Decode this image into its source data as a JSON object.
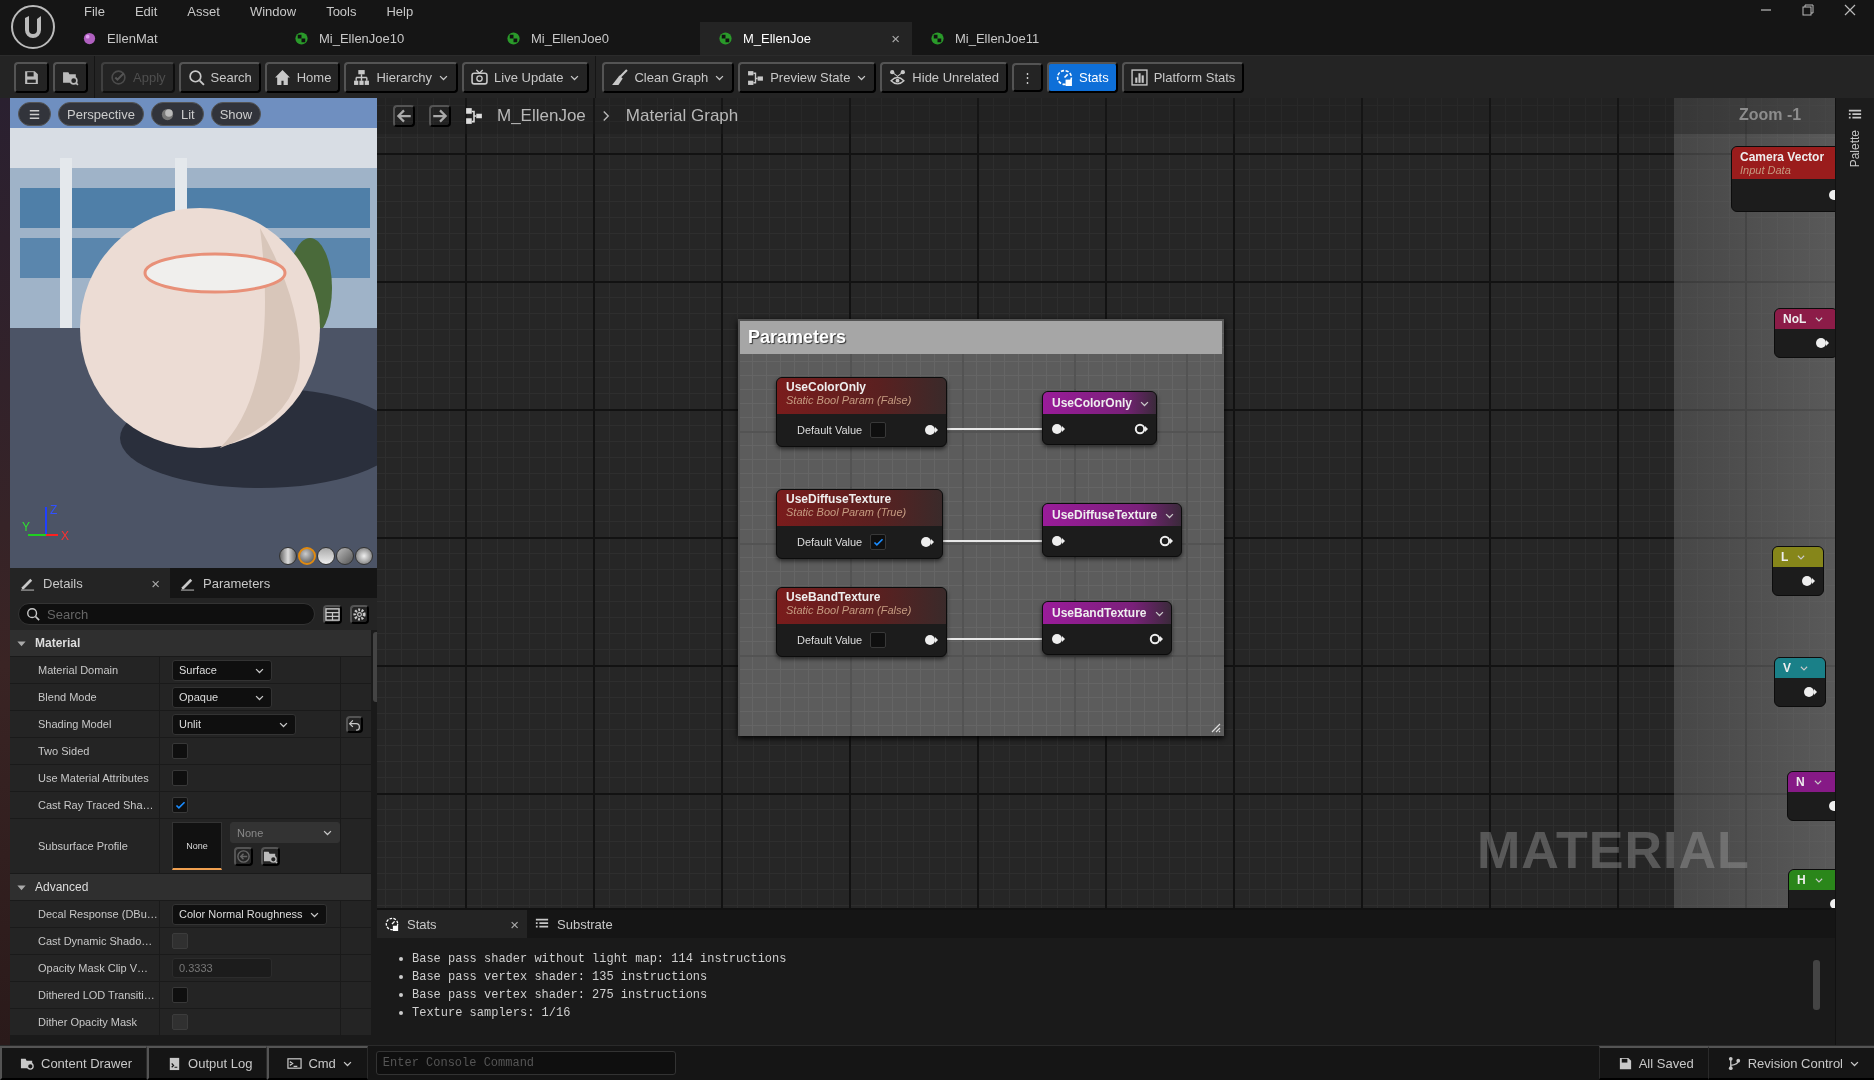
{
  "menu": [
    {
      "label": "File"
    },
    {
      "label": "Edit"
    },
    {
      "label": "Asset"
    },
    {
      "label": "Window"
    },
    {
      "label": "Tools"
    },
    {
      "label": "Help"
    }
  ],
  "document_tabs": [
    {
      "label": "EllenMat",
      "kind": "material",
      "selected": false
    },
    {
      "label": "Mi_EllenJoe10",
      "kind": "instance",
      "selected": false
    },
    {
      "label": "Mi_EllenJoe0",
      "kind": "instance",
      "selected": false
    },
    {
      "label": "M_EllenJoe",
      "kind": "instance",
      "selected": true,
      "close": "×"
    },
    {
      "label": "Mi_EllenJoe11",
      "kind": "instance",
      "selected": false
    }
  ],
  "toolbar": [
    [
      {
        "kind": "save",
        "disabled": false,
        "selected": false
      },
      {
        "kind": "browse",
        "disabled": false,
        "selected": false
      }
    ],
    [
      {
        "kind": "apply",
        "label": "Apply",
        "disabled": true,
        "selected": false
      },
      {
        "kind": "search",
        "label": "Search",
        "disabled": false,
        "selected": false
      },
      {
        "kind": "home",
        "label": "Home",
        "disabled": false,
        "selected": false
      },
      {
        "kind": "hierarchy",
        "label": "Hierarchy",
        "dropdown": true,
        "disabled": false,
        "selected": false
      },
      {
        "kind": "live",
        "label": "Live Update",
        "dropdown": true,
        "disabled": false,
        "selected": false
      }
    ],
    [
      {
        "kind": "clean",
        "label": "Clean Graph",
        "dropdown": true,
        "disabled": false,
        "selected": false
      },
      {
        "kind": "preview",
        "label": "Preview State",
        "dropdown": true,
        "disabled": false,
        "selected": false
      },
      {
        "kind": "hide",
        "label": "Hide Unrelated",
        "disabled": false,
        "selected": false
      },
      {
        "kind": "more",
        "label": "⋮",
        "disabled": false,
        "selected": false
      },
      {
        "kind": "stats",
        "label": "Stats",
        "disabled": false,
        "selected": true
      },
      {
        "kind": "platform",
        "label": "Platform Stats",
        "disabled": false,
        "selected": false
      }
    ]
  ],
  "viewport": {
    "buttons": [
      {
        "kind": "menu"
      },
      {
        "kind": "text",
        "label": "Perspective"
      },
      {
        "kind": "lit",
        "label": "Lit"
      },
      {
        "kind": "text",
        "label": "Show"
      }
    ],
    "axes": [
      "Z",
      "Y",
      "X"
    ],
    "preview_shapes": [
      {
        "kind": "cylinder",
        "selected": false
      },
      {
        "kind": "sphere",
        "selected": true
      },
      {
        "kind": "plane",
        "selected": false
      },
      {
        "kind": "cube",
        "selected": false
      },
      {
        "kind": "mesh",
        "selected": false
      }
    ]
  },
  "details": {
    "tabs": [
      {
        "label": "Details",
        "selected": true,
        "close": "×"
      },
      {
        "label": "Parameters",
        "selected": false
      }
    ],
    "search": {
      "placeholder": "Search"
    },
    "sections": [
      {
        "title": "Material",
        "expanded": true,
        "rows": [
          {
            "label": "Material Domain",
            "kind": "dropdown",
            "value": "Surface",
            "modified": false
          },
          {
            "label": "Blend Mode",
            "kind": "dropdown",
            "value": "Opaque",
            "modified": false
          },
          {
            "label": "Shading Model",
            "kind": "dropdown",
            "value": "Unlit",
            "modified": true
          },
          {
            "label": "Two Sided",
            "kind": "checkbox",
            "checked": false,
            "disabled": false,
            "modified": false
          },
          {
            "label": "Use Material Attributes",
            "kind": "checkbox",
            "checked": false,
            "disabled": false,
            "modified": false
          },
          {
            "label": "Cast Ray Traced Sha…",
            "kind": "checkbox",
            "checked": true,
            "disabled": false,
            "modified": false
          },
          {
            "label": "Subsurface Profile",
            "kind": "asset",
            "thumbnail": "None",
            "value": "None",
            "modified": false
          }
        ]
      },
      {
        "title": "Advanced",
        "expanded": true,
        "rows": [
          {
            "label": "Decal Response (DBu…",
            "kind": "dropdown",
            "value": "Color Normal Roughness",
            "modified": false
          },
          {
            "label": "Cast Dynamic Shado…",
            "kind": "checkbox",
            "checked": false,
            "disabled": true,
            "modified": false
          },
          {
            "label": "Opacity Mask Clip V…",
            "kind": "number",
            "value": "0.3333",
            "disabled": true,
            "modified": false
          },
          {
            "label": "Dithered LOD Transiti…",
            "kind": "checkbox",
            "checked": false,
            "disabled": false,
            "modified": false
          },
          {
            "label": "Dither Opacity Mask",
            "kind": "checkbox",
            "checked": false,
            "disabled": true,
            "modified": false
          }
        ]
      }
    ]
  },
  "graph": {
    "breadcrumb": [
      "M_EllenJoe",
      "Material Graph"
    ],
    "zoom_label": "Zoom -1",
    "watermark": "MATERIAL",
    "comment": {
      "title": "Parameters",
      "parameters": [
        {
          "name": "UseColorOnly",
          "subtitle": "Static Bool Param (False)",
          "pin_label": "Default Value",
          "checked": false
        },
        {
          "name": "UseDiffuseTexture",
          "subtitle": "Static Bool Param (True)",
          "pin_label": "Default Value",
          "checked": true
        },
        {
          "name": "UseBandTexture",
          "subtitle": "Static Bool Param (False)",
          "pin_label": "Default Value",
          "checked": false
        }
      ],
      "switches": [
        {
          "title": "UseColorOnly"
        },
        {
          "title": "UseDiffuseTexture"
        },
        {
          "title": "UseBandTexture"
        }
      ]
    },
    "side_nodes": [
      {
        "title": "Camera Vector",
        "subtitle": "Input Data",
        "color": "#9a1c1c",
        "dropdown": false
      },
      {
        "title": "NoL",
        "color": "#8c1c48",
        "dropdown": true
      },
      {
        "title": "L",
        "color": "#86861a",
        "dropdown": true
      },
      {
        "title": "V",
        "color": "#1a8088",
        "dropdown": true
      },
      {
        "title": "N",
        "color": "#861a86",
        "dropdown": true
      },
      {
        "title": "H",
        "color": "#2a861a",
        "dropdown": true
      }
    ]
  },
  "stats": {
    "tabs": [
      {
        "label": "Stats",
        "selected": true,
        "close": "×"
      },
      {
        "label": "Substrate",
        "selected": false
      }
    ],
    "lines": [
      "Base pass shader without light map: 114 instructions",
      "Base pass vertex shader: 135 instructions",
      "Base pass vertex shader: 275 instructions",
      "Texture samplers: 1/16"
    ]
  },
  "palette": {
    "label": "Palette"
  },
  "status_bar": {
    "left": [
      {
        "kind": "drawer",
        "label": "Content Drawer"
      },
      {
        "kind": "log",
        "label": "Output Log"
      },
      {
        "kind": "cmd",
        "label": "Cmd",
        "dropdown": true
      }
    ],
    "console": {
      "placeholder": "Enter Console Command"
    },
    "right": [
      {
        "kind": "saved",
        "label": "All Saved"
      },
      {
        "kind": "branch",
        "label": "Revision Control",
        "dropdown": true
      }
    ]
  }
}
